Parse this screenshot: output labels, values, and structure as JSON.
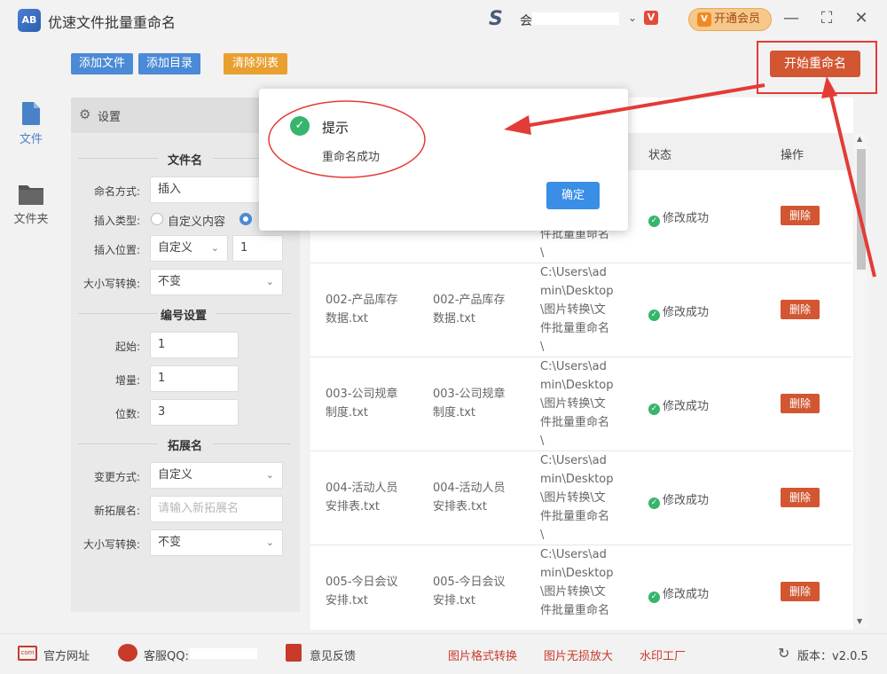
{
  "app": {
    "title": "优速文件批量重命名",
    "logo_text": "AB"
  },
  "account": {
    "logo": "S",
    "name_prefix": "会",
    "vip_badge": "V",
    "upgrade_label": "开通会员"
  },
  "window": {
    "minimize": "—",
    "maximize": "⛶",
    "close": "✕"
  },
  "toolbar": {
    "add_file": "添加文件",
    "add_dir": "添加目录",
    "clear_list": "清除列表",
    "start_rename": "开始重命名"
  },
  "nav": [
    {
      "label": "文件",
      "icon": "file-icon"
    },
    {
      "label": "文件夹",
      "icon": "folder-icon"
    }
  ],
  "settings": {
    "title": "设置",
    "filename_section": "文件名",
    "naming_mode_label": "命名方式:",
    "naming_mode_value": "插入",
    "insert_type_label": "插入类型:",
    "insert_type_option": "自定义内容",
    "insert_pos_label": "插入位置:",
    "insert_pos_value": "自定义",
    "insert_pos_number": "1",
    "case_label": "大小写转换:",
    "case_value": "不变",
    "numbering_section": "编号设置",
    "start_label": "起始:",
    "start_value": "1",
    "step_label": "增量:",
    "step_value": "1",
    "digits_label": "位数:",
    "digits_value": "3",
    "ext_section": "拓展名",
    "ext_mode_label": "变更方式:",
    "ext_mode_value": "自定义",
    "new_ext_label": "新拓展名:",
    "new_ext_placeholder": "请输入新拓展名",
    "ext_case_label": "大小写转换:",
    "ext_case_value": "不变"
  },
  "table": {
    "headers": {
      "status": "状态",
      "action": "操作"
    },
    "rows": [
      {
        "orig": "",
        "new": "",
        "path": [
          "件批量重命名",
          "\\"
        ],
        "status": "修改成功",
        "action": "删除"
      },
      {
        "orig": [
          "002-产品库存",
          "数据.txt"
        ],
        "new": [
          "002-产品库存",
          "数据.txt"
        ],
        "path": [
          "C:\\Users\\ad",
          "min\\Desktop",
          "\\图片转换\\文",
          "件批量重命名",
          "\\"
        ],
        "status": "修改成功",
        "action": "删除"
      },
      {
        "orig": [
          "003-公司规章",
          "制度.txt"
        ],
        "new": [
          "003-公司规章",
          "制度.txt"
        ],
        "path": [
          "C:\\Users\\ad",
          "min\\Desktop",
          "\\图片转换\\文",
          "件批量重命名",
          "\\"
        ],
        "status": "修改成功",
        "action": "删除"
      },
      {
        "orig": [
          "004-活动人员",
          "安排表.txt"
        ],
        "new": [
          "004-活动人员",
          "安排表.txt"
        ],
        "path": [
          "C:\\Users\\ad",
          "min\\Desktop",
          "\\图片转换\\文",
          "件批量重命名",
          "\\"
        ],
        "status": "修改成功",
        "action": "删除"
      },
      {
        "orig": [
          "005-今日会议",
          "安排.txt"
        ],
        "new": [
          "005-今日会议",
          "安排.txt"
        ],
        "path": [
          "C:\\Users\\ad",
          "min\\Desktop",
          "\\图片转换\\文",
          "件批量重命名"
        ],
        "status": "修改成功",
        "action": "删除"
      }
    ]
  },
  "footer": {
    "website": "官方网址",
    "qq": "客服QQ:",
    "feedback": "意见反馈",
    "img_convert": "图片格式转换",
    "img_enlarge": "图片无损放大",
    "watermark": "水印工厂",
    "version": "版本：v2.0.5"
  },
  "dialog": {
    "title": "提示",
    "message": "重命名成功",
    "ok": "确定"
  },
  "colors": {
    "accent": "#4a8ad6",
    "danger": "#d25631",
    "success": "#36b56c",
    "annotation": "#e33b36"
  }
}
